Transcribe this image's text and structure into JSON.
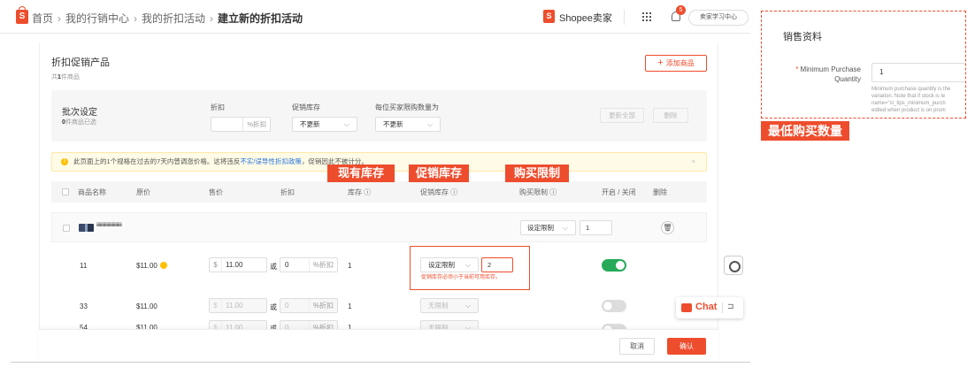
{
  "breadcrumb": [
    "首页",
    "我的行销中心",
    "我的折扣活动",
    "建立新的折扣活动"
  ],
  "header": {
    "seller_center": "Shopee卖家",
    "bell_count": "5",
    "account": "卖家学习中心"
  },
  "section": {
    "title": "折扣促销产品",
    "sub_prefix": "共",
    "sub_count": "1",
    "sub_suffix": "件商品",
    "add_button": "添加商品"
  },
  "batch": {
    "title": "批次设定",
    "selected_count": "0",
    "selected_suffix": "件商品已选",
    "discount_label": "折扣",
    "discount_suffix": "%折扣",
    "stock_label": "促销库存",
    "stock_value": "不更新",
    "limit_label": "每位买家限购数量为",
    "limit_value": "不更新",
    "update_all": "更新全部",
    "delete": "删除"
  },
  "warning": {
    "text": "此页面上的1个规格在过去的7天内曾调涨价格。这将违反",
    "link": "不实/误导性折扣政策",
    "tail": "，促销因此不被计分。",
    "close": "×"
  },
  "table": {
    "headers": [
      "商品名称",
      "原价",
      "售价",
      "折扣",
      "库存",
      "促销库存",
      "购买限制",
      "开启 / 关闭",
      "删除"
    ],
    "product_name": "iiiiiiiiiiiiiiiiiiiiiiiiiiiiiiiiii",
    "group_limit_select": "设定限制",
    "group_limit_value": "1",
    "rows": [
      {
        "variation": "11",
        "price": "$11.00",
        "sale_price": "11.00",
        "discount": "0",
        "stock": "1",
        "promo_stock": "设定限制",
        "promo_value": "2",
        "error": "促销库存必须小于当前可用库存。"
      },
      {
        "variation": "33",
        "price": "$11.00",
        "sale_price": "11.00",
        "discount": "0",
        "stock": "1",
        "promo_stock": "无限制"
      },
      {
        "variation": "54",
        "price": "$11.00",
        "sale_price": "11.00",
        "discount": "0",
        "stock": "1",
        "promo_stock": "无限制"
      }
    ],
    "currency": "$",
    "or": "或",
    "discount_suffix": "%折扣"
  },
  "annotations": {
    "current_stock": "现有库存",
    "promo_stock": "促销库存",
    "purchase_limit": "购买限制",
    "min_qty": "最低购买数量"
  },
  "footer": {
    "cancel": "取消",
    "confirm": "确认"
  },
  "chat": {
    "label": "Chat"
  },
  "right_panel": {
    "title": "销售资料",
    "label": "Minimum Purchase Quantity",
    "value": "1",
    "help": [
      "Minimum purchase quantity is the",
      "variation. Note that if stock is le",
      "name=\"sl_tips_minimum_purch",
      "edited when product is on prom"
    ]
  },
  "colors": {
    "brand": "#ee4d2d",
    "toggle_on": "#26aa59",
    "link": "#2673dd"
  }
}
